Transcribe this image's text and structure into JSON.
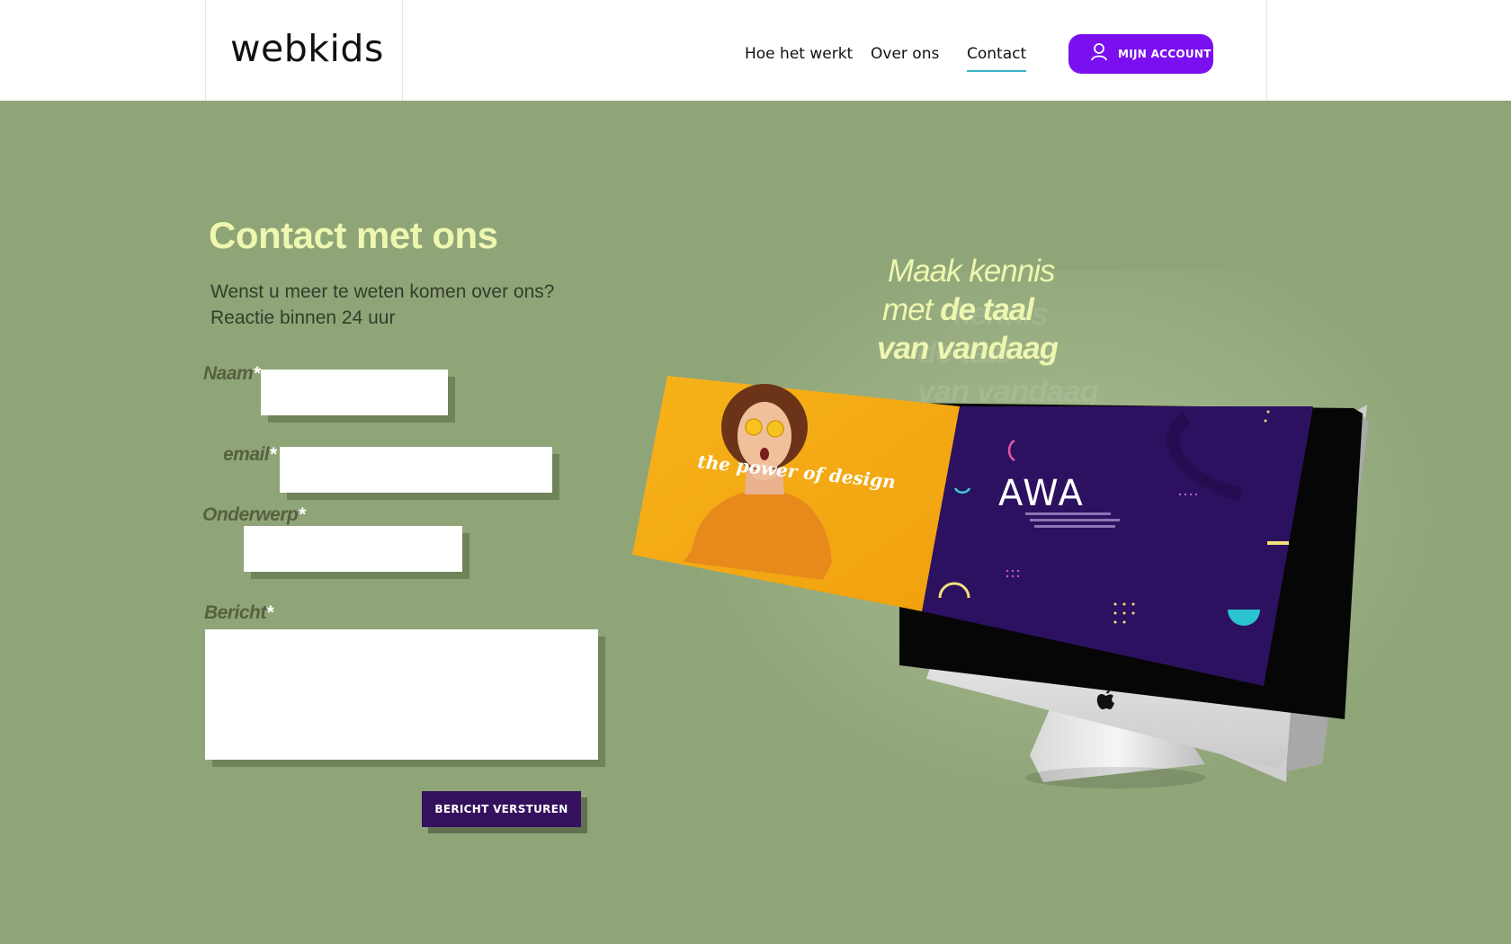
{
  "header": {
    "logo": "webkids",
    "nav": [
      {
        "label": "Hoe het werkt"
      },
      {
        "label": "Over ons"
      },
      {
        "label": "Contact"
      }
    ],
    "account_label": "MIJN ACCOUNT"
  },
  "contact": {
    "title": "Contact met ons",
    "subtitle_line1": "Wenst u meer te weten komen over ons?",
    "subtitle_line2": "Reactie binnen 24 uur",
    "fields": {
      "naam": {
        "label": "Naam",
        "required": "*",
        "value": ""
      },
      "email": {
        "label": "email",
        "required": "*",
        "value": ""
      },
      "onderwerp": {
        "label": "Onderwerp",
        "required": "*",
        "value": ""
      },
      "bericht": {
        "label": "Bericht",
        "required": "*",
        "value": ""
      }
    },
    "submit_label": "BERICHT VERSTUREN"
  },
  "hero": {
    "tagline_line1": "Maak kennis",
    "tagline_line2_prefix": "met",
    "tagline_line2_bold": "de taal",
    "tagline_line3": "van vandaag",
    "ghost_line1": "kennis",
    "ghost_line2": "de taal",
    "ghost_line3": "van vandaag",
    "slide1_text": "the power of design",
    "slide2_title": "AWA"
  },
  "colors": {
    "background": "#8fa578",
    "accent": "#7a10f0",
    "title": "#eef7b0",
    "submit": "#35105d",
    "active_underline": "#3ab5c9"
  }
}
